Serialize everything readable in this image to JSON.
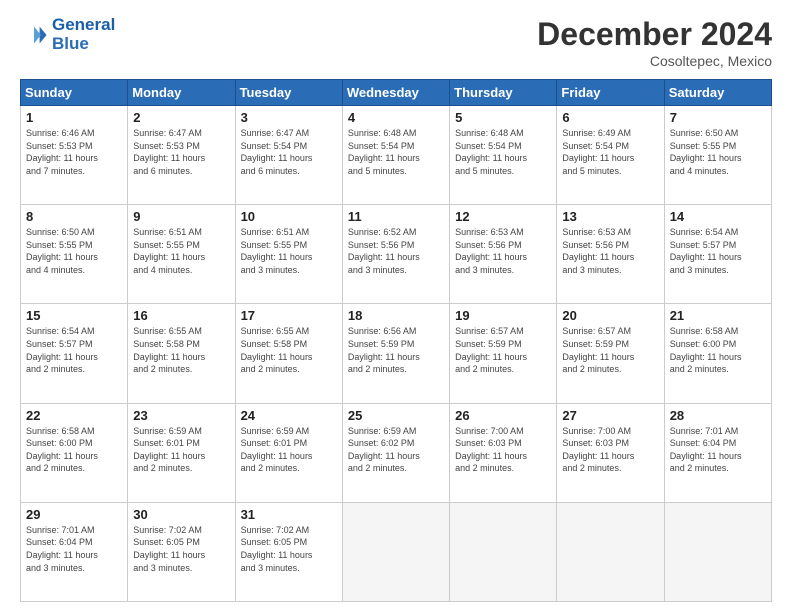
{
  "header": {
    "logo_line1": "General",
    "logo_line2": "Blue",
    "month": "December 2024",
    "location": "Cosoltepec, Mexico"
  },
  "days_of_week": [
    "Sunday",
    "Monday",
    "Tuesday",
    "Wednesday",
    "Thursday",
    "Friday",
    "Saturday"
  ],
  "weeks": [
    [
      {
        "num": "1",
        "info": "Sunrise: 6:46 AM\nSunset: 5:53 PM\nDaylight: 11 hours\nand 7 minutes."
      },
      {
        "num": "2",
        "info": "Sunrise: 6:47 AM\nSunset: 5:53 PM\nDaylight: 11 hours\nand 6 minutes."
      },
      {
        "num": "3",
        "info": "Sunrise: 6:47 AM\nSunset: 5:54 PM\nDaylight: 11 hours\nand 6 minutes."
      },
      {
        "num": "4",
        "info": "Sunrise: 6:48 AM\nSunset: 5:54 PM\nDaylight: 11 hours\nand 5 minutes."
      },
      {
        "num": "5",
        "info": "Sunrise: 6:48 AM\nSunset: 5:54 PM\nDaylight: 11 hours\nand 5 minutes."
      },
      {
        "num": "6",
        "info": "Sunrise: 6:49 AM\nSunset: 5:54 PM\nDaylight: 11 hours\nand 5 minutes."
      },
      {
        "num": "7",
        "info": "Sunrise: 6:50 AM\nSunset: 5:55 PM\nDaylight: 11 hours\nand 4 minutes."
      }
    ],
    [
      {
        "num": "8",
        "info": "Sunrise: 6:50 AM\nSunset: 5:55 PM\nDaylight: 11 hours\nand 4 minutes."
      },
      {
        "num": "9",
        "info": "Sunrise: 6:51 AM\nSunset: 5:55 PM\nDaylight: 11 hours\nand 4 minutes."
      },
      {
        "num": "10",
        "info": "Sunrise: 6:51 AM\nSunset: 5:55 PM\nDaylight: 11 hours\nand 3 minutes."
      },
      {
        "num": "11",
        "info": "Sunrise: 6:52 AM\nSunset: 5:56 PM\nDaylight: 11 hours\nand 3 minutes."
      },
      {
        "num": "12",
        "info": "Sunrise: 6:53 AM\nSunset: 5:56 PM\nDaylight: 11 hours\nand 3 minutes."
      },
      {
        "num": "13",
        "info": "Sunrise: 6:53 AM\nSunset: 5:56 PM\nDaylight: 11 hours\nand 3 minutes."
      },
      {
        "num": "14",
        "info": "Sunrise: 6:54 AM\nSunset: 5:57 PM\nDaylight: 11 hours\nand 3 minutes."
      }
    ],
    [
      {
        "num": "15",
        "info": "Sunrise: 6:54 AM\nSunset: 5:57 PM\nDaylight: 11 hours\nand 2 minutes."
      },
      {
        "num": "16",
        "info": "Sunrise: 6:55 AM\nSunset: 5:58 PM\nDaylight: 11 hours\nand 2 minutes."
      },
      {
        "num": "17",
        "info": "Sunrise: 6:55 AM\nSunset: 5:58 PM\nDaylight: 11 hours\nand 2 minutes."
      },
      {
        "num": "18",
        "info": "Sunrise: 6:56 AM\nSunset: 5:59 PM\nDaylight: 11 hours\nand 2 minutes."
      },
      {
        "num": "19",
        "info": "Sunrise: 6:57 AM\nSunset: 5:59 PM\nDaylight: 11 hours\nand 2 minutes."
      },
      {
        "num": "20",
        "info": "Sunrise: 6:57 AM\nSunset: 5:59 PM\nDaylight: 11 hours\nand 2 minutes."
      },
      {
        "num": "21",
        "info": "Sunrise: 6:58 AM\nSunset: 6:00 PM\nDaylight: 11 hours\nand 2 minutes."
      }
    ],
    [
      {
        "num": "22",
        "info": "Sunrise: 6:58 AM\nSunset: 6:00 PM\nDaylight: 11 hours\nand 2 minutes."
      },
      {
        "num": "23",
        "info": "Sunrise: 6:59 AM\nSunset: 6:01 PM\nDaylight: 11 hours\nand 2 minutes."
      },
      {
        "num": "24",
        "info": "Sunrise: 6:59 AM\nSunset: 6:01 PM\nDaylight: 11 hours\nand 2 minutes."
      },
      {
        "num": "25",
        "info": "Sunrise: 6:59 AM\nSunset: 6:02 PM\nDaylight: 11 hours\nand 2 minutes."
      },
      {
        "num": "26",
        "info": "Sunrise: 7:00 AM\nSunset: 6:03 PM\nDaylight: 11 hours\nand 2 minutes."
      },
      {
        "num": "27",
        "info": "Sunrise: 7:00 AM\nSunset: 6:03 PM\nDaylight: 11 hours\nand 2 minutes."
      },
      {
        "num": "28",
        "info": "Sunrise: 7:01 AM\nSunset: 6:04 PM\nDaylight: 11 hours\nand 2 minutes."
      }
    ],
    [
      {
        "num": "29",
        "info": "Sunrise: 7:01 AM\nSunset: 6:04 PM\nDaylight: 11 hours\nand 3 minutes."
      },
      {
        "num": "30",
        "info": "Sunrise: 7:02 AM\nSunset: 6:05 PM\nDaylight: 11 hours\nand 3 minutes."
      },
      {
        "num": "31",
        "info": "Sunrise: 7:02 AM\nSunset: 6:05 PM\nDaylight: 11 hours\nand 3 minutes."
      },
      null,
      null,
      null,
      null
    ]
  ]
}
